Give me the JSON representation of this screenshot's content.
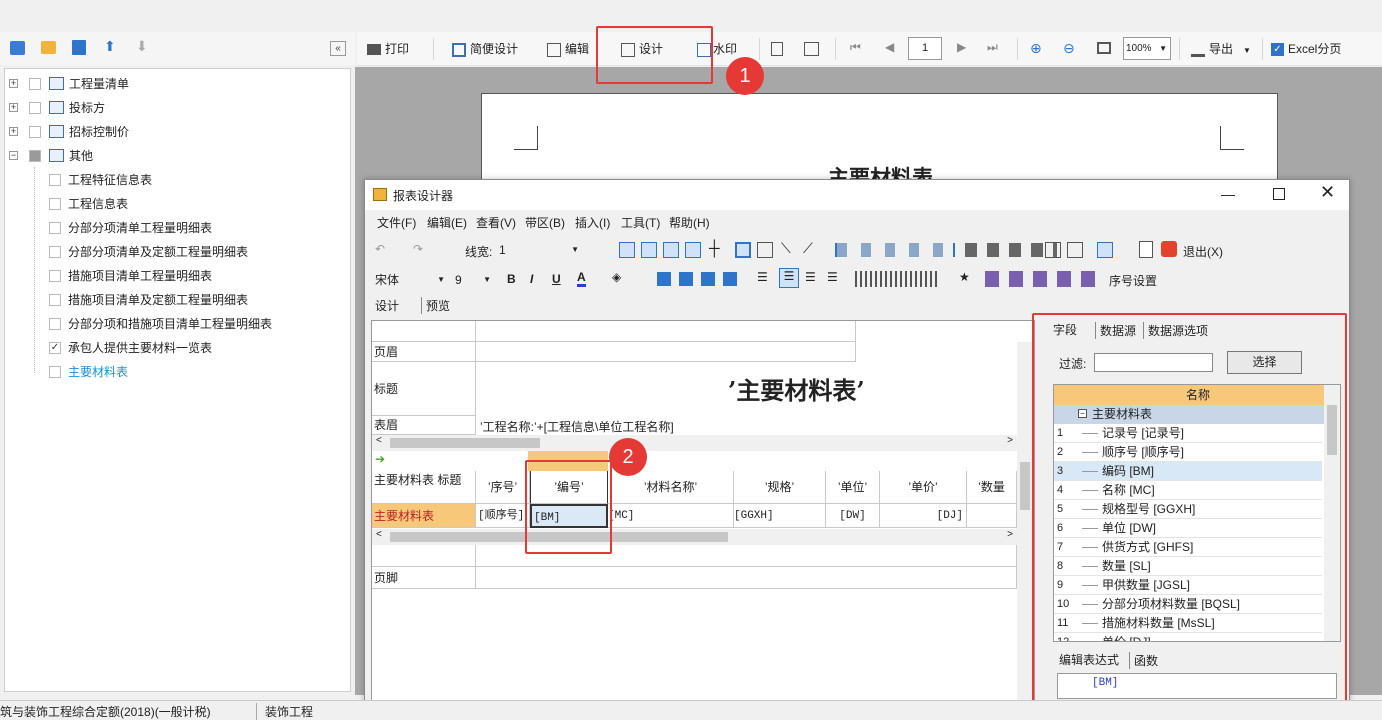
{
  "main_toolbar": {
    "print": "打印",
    "simple_design": "简便设计",
    "edit": "编辑",
    "design": "设计",
    "watermark": "水印",
    "page_number": "1",
    "zoom": "100%",
    "export": "导出",
    "excel_paging": "Excel分页"
  },
  "tree": {
    "items": [
      {
        "label": "工程量清单"
      },
      {
        "label": "投标方"
      },
      {
        "label": "招标控制价"
      },
      {
        "label": "其他"
      },
      {
        "label": "工程特征信息表"
      },
      {
        "label": "工程信息表"
      },
      {
        "label": "分部分项清单工程量明细表"
      },
      {
        "label": "分部分项清单及定额工程量明细表"
      },
      {
        "label": "措施项目清单工程量明细表"
      },
      {
        "label": "措施项目清单及定额工程量明细表"
      },
      {
        "label": "分部分项和措施项目清单工程量明细表"
      },
      {
        "label": "承包人提供主要材料一览表"
      },
      {
        "label": "主要材料表"
      }
    ]
  },
  "preview": {
    "title": "主要材料表"
  },
  "designer": {
    "title": "报表设计器",
    "menus": [
      "文件(F)",
      "编辑(E)",
      "查看(V)",
      "带区(B)",
      "插入(I)",
      "工具(T)",
      "帮助(H)"
    ],
    "line_width_label": "线宽:",
    "line_width_value": "1",
    "exit_label": "退出(X)",
    "font_name": "宋体",
    "font_size": "9",
    "serial_setting": "序号设置",
    "tabs": [
      "设计",
      "预览"
    ],
    "bands": {
      "page_header": "页眉",
      "title": "标题",
      "table_header": "表眉",
      "column_header": "主要材料表 标题",
      "data": "主要材料表",
      "footer": "页脚"
    },
    "title_expr": "’主要材料表’",
    "table_header_expr": "’工程名称:’+[工程信息\\单位工程名称]",
    "col_headers": [
      "’序号’",
      "’编号’",
      "’材料名称’",
      "’规格’",
      "’单位’",
      "’单价’",
      "’数量"
    ],
    "col_values": [
      "[顺序号]",
      "[BM]",
      "[MC]",
      "[GGXH]",
      "[DW]",
      "[DJ]",
      ""
    ],
    "right_tabs": [
      "字段",
      "数据源",
      "数据源选项"
    ],
    "filter_label": "过滤:",
    "select_button": "选择",
    "field_col_header": "名称",
    "field_root": "主要材料表",
    "fields": [
      {
        "num": "1",
        "name": "记录号 [记录号]"
      },
      {
        "num": "2",
        "name": "顺序号 [顺序号]"
      },
      {
        "num": "3",
        "name": "编码 [BM]"
      },
      {
        "num": "4",
        "name": "名称 [MC]"
      },
      {
        "num": "5",
        "name": "规格型号 [GGXH]"
      },
      {
        "num": "6",
        "name": "单位 [DW]"
      },
      {
        "num": "7",
        "name": "供货方式 [GHFS]"
      },
      {
        "num": "8",
        "name": "数量 [SL]"
      },
      {
        "num": "9",
        "name": "甲供数量 [JGSL]"
      },
      {
        "num": "10",
        "name": "分部分项材料数量 [BQSL]"
      },
      {
        "num": "11",
        "name": "措施材料数量 [MsSL]"
      },
      {
        "num": "12",
        "name": "单价 [DJ]"
      }
    ],
    "expr_tabs": [
      "编辑表达式",
      "函数"
    ],
    "expr_value": "[BM]"
  },
  "status": {
    "left": "筑与装饰工程综合定额(2018)(一般计税)",
    "middle": "装饰工程"
  },
  "annotations": {
    "badge1": "1",
    "badge2": "2"
  },
  "colors": {
    "highlight_red": "#e53935",
    "field_header": "#f7c77a",
    "selected_row": "#d9e8f7",
    "link_blue": "#1a8fd6"
  }
}
